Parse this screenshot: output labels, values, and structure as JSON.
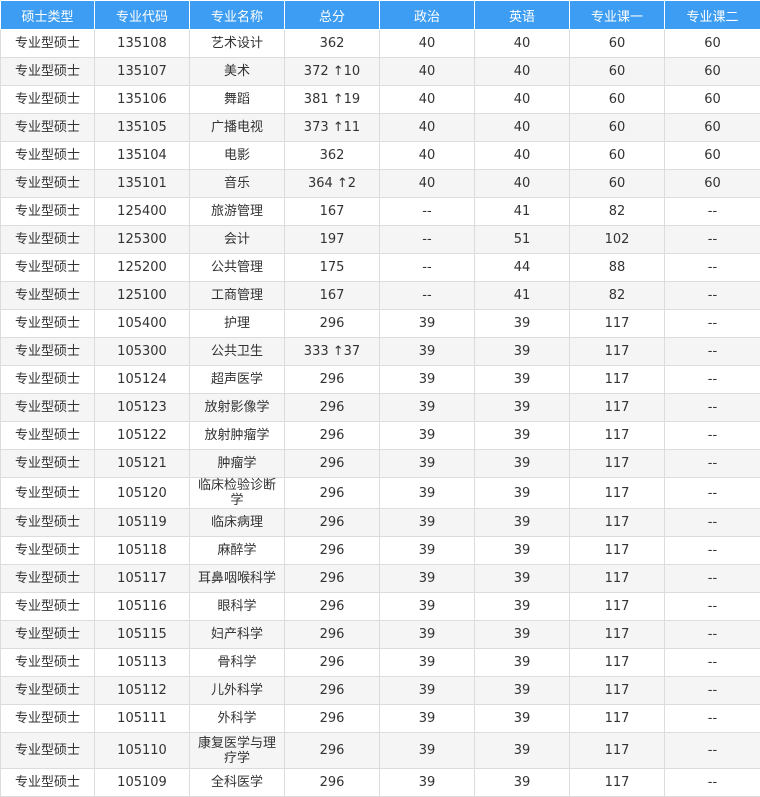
{
  "headers": [
    "硕士类型",
    "专业代码",
    "专业名称",
    "总分",
    "政治",
    "英语",
    "专业课一",
    "专业课二"
  ],
  "rows": [
    [
      "专业型硕士",
      "135108",
      "艺术设计",
      "362",
      "40",
      "40",
      "60",
      "60"
    ],
    [
      "专业型硕士",
      "135107",
      "美术",
      "372 ↑10",
      "40",
      "40",
      "60",
      "60"
    ],
    [
      "专业型硕士",
      "135106",
      "舞蹈",
      "381 ↑19",
      "40",
      "40",
      "60",
      "60"
    ],
    [
      "专业型硕士",
      "135105",
      "广播电视",
      "373 ↑11",
      "40",
      "40",
      "60",
      "60"
    ],
    [
      "专业型硕士",
      "135104",
      "电影",
      "362",
      "40",
      "40",
      "60",
      "60"
    ],
    [
      "专业型硕士",
      "135101",
      "音乐",
      "364 ↑2",
      "40",
      "40",
      "60",
      "60"
    ],
    [
      "专业型硕士",
      "125400",
      "旅游管理",
      "167",
      "--",
      "41",
      "82",
      "--"
    ],
    [
      "专业型硕士",
      "125300",
      "会计",
      "197",
      "--",
      "51",
      "102",
      "--"
    ],
    [
      "专业型硕士",
      "125200",
      "公共管理",
      "175",
      "--",
      "44",
      "88",
      "--"
    ],
    [
      "专业型硕士",
      "125100",
      "工商管理",
      "167",
      "--",
      "41",
      "82",
      "--"
    ],
    [
      "专业型硕士",
      "105400",
      "护理",
      "296",
      "39",
      "39",
      "117",
      "--"
    ],
    [
      "专业型硕士",
      "105300",
      "公共卫生",
      "333 ↑37",
      "39",
      "39",
      "117",
      "--"
    ],
    [
      "专业型硕士",
      "105124",
      "超声医学",
      "296",
      "39",
      "39",
      "117",
      "--"
    ],
    [
      "专业型硕士",
      "105123",
      "放射影像学",
      "296",
      "39",
      "39",
      "117",
      "--"
    ],
    [
      "专业型硕士",
      "105122",
      "放射肿瘤学",
      "296",
      "39",
      "39",
      "117",
      "--"
    ],
    [
      "专业型硕士",
      "105121",
      "肿瘤学",
      "296",
      "39",
      "39",
      "117",
      "--"
    ],
    [
      "专业型硕士",
      "105120",
      "临床检验诊断学",
      "296",
      "39",
      "39",
      "117",
      "--"
    ],
    [
      "专业型硕士",
      "105119",
      "临床病理",
      "296",
      "39",
      "39",
      "117",
      "--"
    ],
    [
      "专业型硕士",
      "105118",
      "麻醉学",
      "296",
      "39",
      "39",
      "117",
      "--"
    ],
    [
      "专业型硕士",
      "105117",
      "耳鼻咽喉科学",
      "296",
      "39",
      "39",
      "117",
      "--"
    ],
    [
      "专业型硕士",
      "105116",
      "眼科学",
      "296",
      "39",
      "39",
      "117",
      "--"
    ],
    [
      "专业型硕士",
      "105115",
      "妇产科学",
      "296",
      "39",
      "39",
      "117",
      "--"
    ],
    [
      "专业型硕士",
      "105113",
      "骨科学",
      "296",
      "39",
      "39",
      "117",
      "--"
    ],
    [
      "专业型硕士",
      "105112",
      "儿外科学",
      "296",
      "39",
      "39",
      "117",
      "--"
    ],
    [
      "专业型硕士",
      "105111",
      "外科学",
      "296",
      "39",
      "39",
      "117",
      "--"
    ],
    [
      "专业型硕士",
      "105110",
      "康复医学与理疗学",
      "296",
      "39",
      "39",
      "117",
      "--"
    ],
    [
      "专业型硕士",
      "105109",
      "全科医学",
      "296",
      "39",
      "39",
      "117",
      "--"
    ]
  ]
}
